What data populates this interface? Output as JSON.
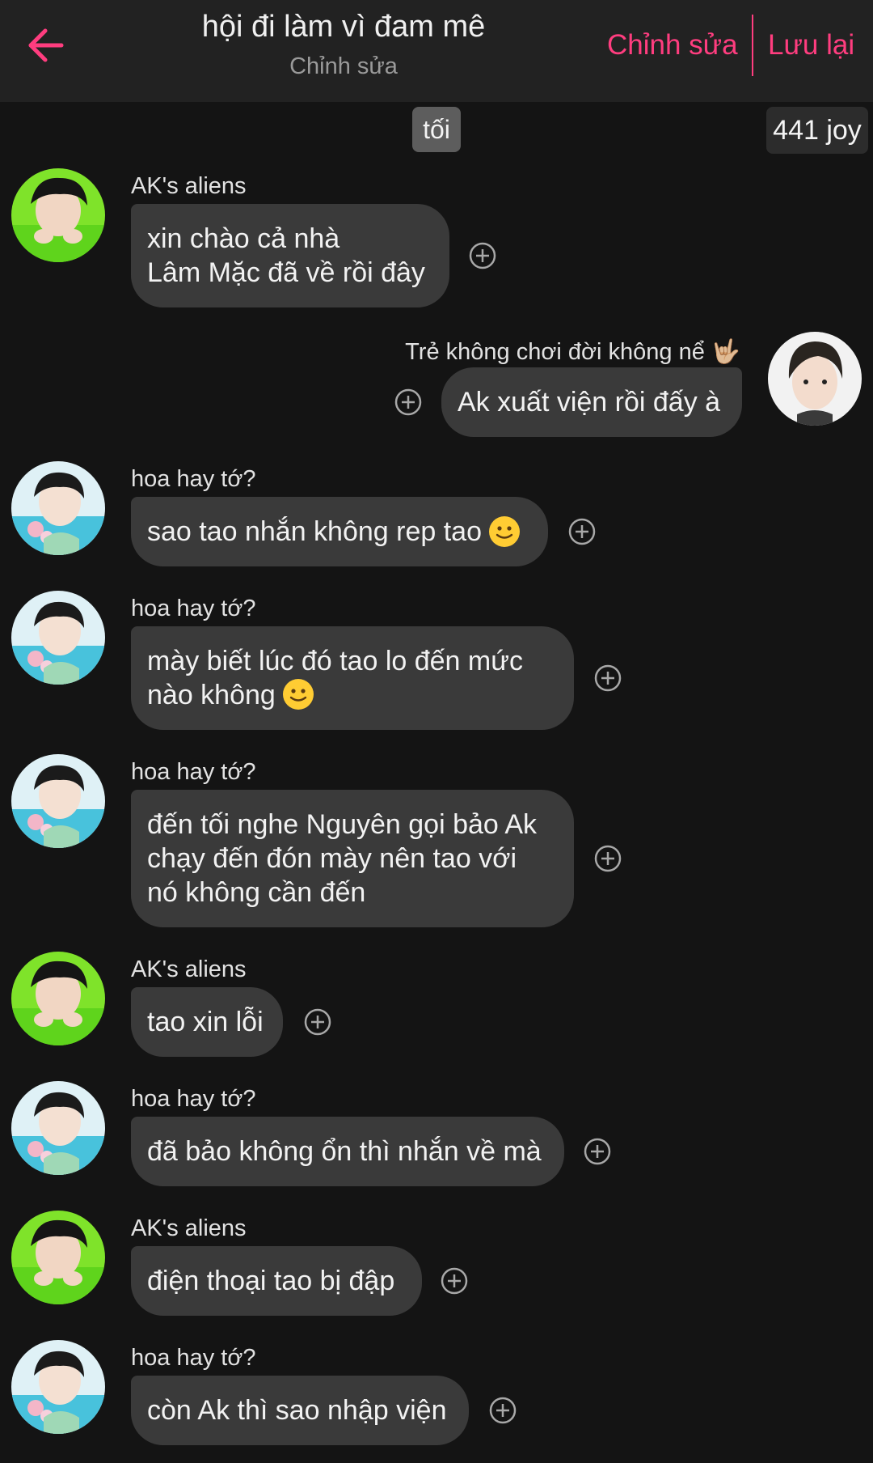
{
  "header": {
    "title": "hội đi làm vì đam mê",
    "subtitle": "Chỉnh sửa",
    "edit_label": "Chỉnh sửa",
    "save_label": "Lưu lại",
    "accent_color": "#ff3d7f"
  },
  "time_label": "tối",
  "joy_count": "441 joy",
  "messages": [
    {
      "sender": "AK's aliens",
      "text": "xin chào cả nhà\nLâm Mặc đã về rồi đây",
      "side": "left"
    },
    {
      "sender": "Trẻ không chơi đời không nể 🤟🏼",
      "text": "Ak xuất viện rồi đấy à",
      "side": "right"
    },
    {
      "sender": "hoa hay tớ?",
      "text": "sao tao nhắn không rep tao",
      "emoji": "slight-smile",
      "side": "left"
    },
    {
      "sender": "hoa hay tớ?",
      "text": "mày biết lúc đó tao lo đến mức\nnào không",
      "emoji": "slight-smile",
      "side": "left"
    },
    {
      "sender": "hoa hay tớ?",
      "text": "đến tối nghe Nguyên gọi bảo Ak\nchạy đến đón mày nên tao với\nnó không cần đến",
      "side": "left"
    },
    {
      "sender": "AK's aliens",
      "text": "tao xin lỗi",
      "side": "left"
    },
    {
      "sender": "hoa hay tớ?",
      "text": "đã bảo không ổn thì nhắn về mà",
      "side": "left"
    },
    {
      "sender": "AK's aliens",
      "text": "điện thoại tao bị đập",
      "side": "left"
    },
    {
      "sender": "hoa hay tớ?",
      "text": "còn Ak thì sao nhập viện",
      "side": "left"
    }
  ]
}
